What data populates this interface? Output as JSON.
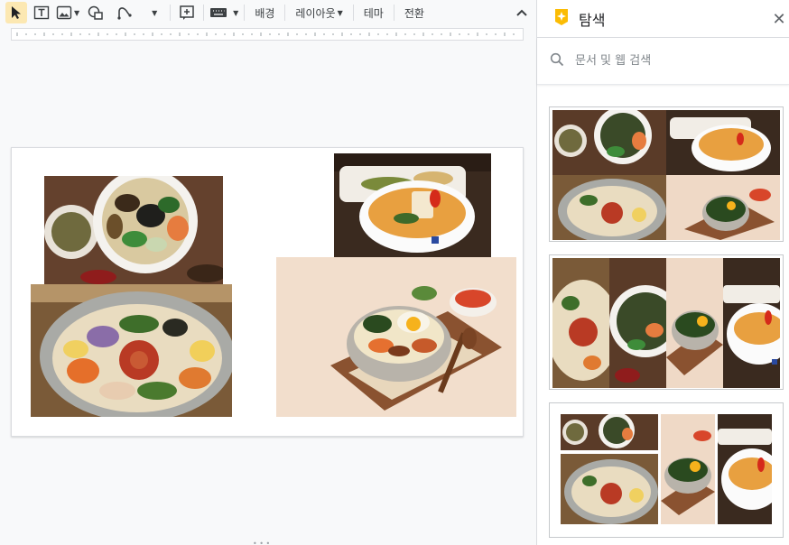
{
  "toolbar": {
    "select_icon": "cursor-icon",
    "textbox_icon": "textbox-icon",
    "image_icon": "image-icon",
    "shape_icon": "shape-icon",
    "line_icon": "line-icon",
    "comment_icon": "add-comment-icon",
    "keyboard_icon": "keyboard-icon",
    "background_label": "배경",
    "layout_label": "레이아웃",
    "theme_label": "테마",
    "transition_label": "전환"
  },
  "panel": {
    "title": "탐색",
    "search_placeholder": "문서 및 웹 검색"
  },
  "colors": {
    "accent_yellow": "#fbbc04",
    "toolbar_active": "#fce8b2"
  }
}
